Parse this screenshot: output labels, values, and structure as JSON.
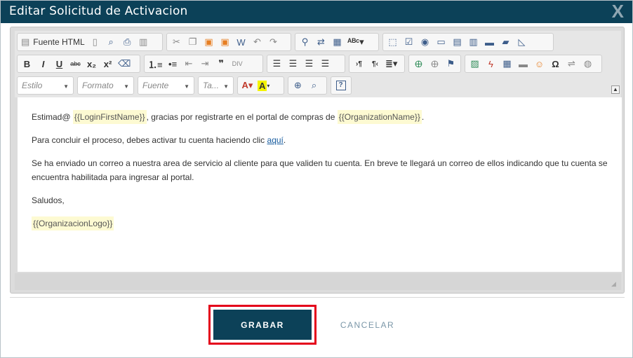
{
  "dialog": {
    "title": "Editar Solicitud de Activacion",
    "close_glyph": "X"
  },
  "toolbar": {
    "row1": {
      "source_label": "Fuente HTML",
      "icons": [
        "document-icon",
        "new-page-icon",
        "preview-icon",
        "print-icon",
        "templates-icon",
        "cut-icon",
        "copy-icon",
        "paste-icon",
        "paste-text-icon",
        "paste-word-icon",
        "undo-icon",
        "redo-icon",
        "find-icon",
        "replace-icon",
        "select-all-icon",
        "spellcheck-icon",
        "form-icon",
        "checkbox-icon",
        "radio-icon",
        "textfield-icon",
        "textarea-icon",
        "select-field-icon",
        "button-field-icon",
        "image-button-icon",
        "hidden-field-icon"
      ]
    },
    "row2": {
      "bold": "B",
      "italic": "I",
      "underline": "U",
      "strike": "abc",
      "subscript": "x₂",
      "superscript": "x²"
    },
    "row3": {
      "style_combo": "Estilo",
      "format_combo": "Formato",
      "font_combo": "Fuente",
      "size_combo": "Ta..."
    },
    "help_glyph": "?"
  },
  "content": {
    "p1_before": "Estimad@ ",
    "p1_ph": "{{LoginFirstName}}",
    "p1_middle": ", gracias por registrarte en el portal de compras de ",
    "p1_ph2": "{{OrganizationName}}",
    "p1_end": ".",
    "p2_before": "Para concluir el proceso, debes activar tu cuenta haciendo clic ",
    "p2_link": "aquí",
    "p2_end": ".",
    "p3": "Se ha enviado un correo a nuestra area de servicio al cliente para que validen tu cuenta. En breve te llegará un correo de ellos indicando que tu cuenta se encuentra habilitada para ingresar al portal.",
    "p4": "Saludos,",
    "p5_ph": "{{OrganizacionLogo}}"
  },
  "actions": {
    "save_label": "GRABAR",
    "cancel_label": "CANCELAR"
  },
  "colors": {
    "titlebar": "#0c4158",
    "primary_button": "#0c4158",
    "highlight_outline": "#e4001b",
    "placeholder_bg": "#fdfad2",
    "link": "#1a5ea0"
  }
}
